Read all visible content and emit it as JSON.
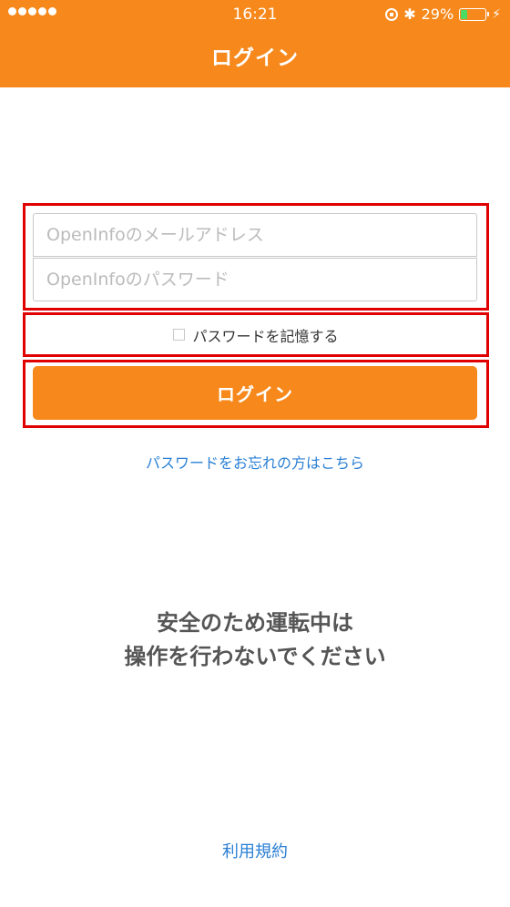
{
  "status_bar": {
    "time": "16:21",
    "battery_percent": "29%",
    "battery_level": 0.29,
    "signal_dots": 5
  },
  "header": {
    "title": "ログイン"
  },
  "form": {
    "email_placeholder": "OpenInfoのメールアドレス",
    "password_placeholder": "OpenInfoのパスワード",
    "remember_label": "パスワードを記憶する",
    "remember_checked": false,
    "login_button": "ログイン"
  },
  "forgot_link": "パスワードをお忘れの方はこちら",
  "warning": {
    "line1": "安全のため運転中は",
    "line2": "操作を行わないでください"
  },
  "terms_link": "利用規約",
  "colors": {
    "brand_orange": "#f7891c",
    "link_blue": "#2a7fd4",
    "highlight_red": "#e00000"
  }
}
